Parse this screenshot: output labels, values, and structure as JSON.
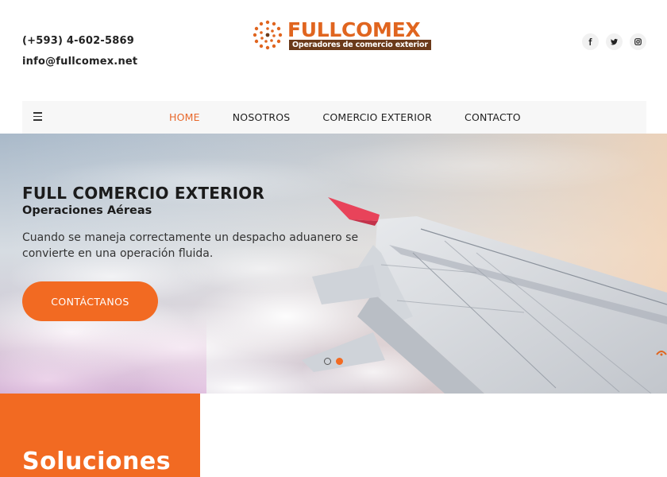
{
  "header": {
    "phone": "(+593) 4-602-5869",
    "email": "info@fullcomex.net",
    "logo": {
      "name": "FULLCOMEX",
      "tagline": "Operadores de comercio exterior",
      "color": "#e0651f",
      "tag_color": "#6b3a1a"
    },
    "social": [
      {
        "icon": "facebook-icon",
        "label": "f"
      },
      {
        "icon": "twitter-icon",
        "label": "t"
      },
      {
        "icon": "instagram-icon",
        "label": "ig"
      }
    ]
  },
  "nav": {
    "menu_icon": "hamburger-icon",
    "items": [
      {
        "label": "HOME",
        "active": true
      },
      {
        "label": "NOSOTROS",
        "active": false
      },
      {
        "label": "COMERCIO EXTERIOR",
        "active": false
      },
      {
        "label": "CONTACTO",
        "active": false
      }
    ],
    "active_color": "#e8682b"
  },
  "hero": {
    "title": "FULL COMERCIO EXTERIOR",
    "subtitle": "Operaciones Aéreas",
    "text": "Cuando se maneja correctamente un despacho aduanero se convierte en una operación fluida.",
    "button_label": "CONTÁCTANOS",
    "button_color": "#f26a22",
    "slides": 2,
    "active_slide": 2
  },
  "section": {
    "title": "Soluciones",
    "color": "#f26a22"
  }
}
